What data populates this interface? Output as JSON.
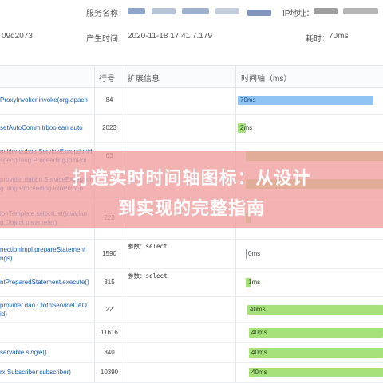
{
  "header": {
    "service_label": "服务名称：",
    "ip_label": "IP地址：",
    "trace_id_fragment": "09d2073",
    "created_label": "产生时间：",
    "created_value": "2020-11-18 17:41:7.179",
    "elapsed_label": "耗时：",
    "elapsed_value": "70ms"
  },
  "table": {
    "col_line": "行号",
    "col_ext": "扩展信息",
    "col_timeline": "时间轴（ms）"
  },
  "rows": [
    {
      "method": "ProxyInvoker.invoke(org.apach",
      "line": "84",
      "ext": "",
      "bar": "70ms",
      "bar_color": "blue"
    },
    {
      "method": "setAutoCommit(boolean auto",
      "line": "2023",
      "ext": "",
      "bar": "2ms",
      "bar_color": "green"
    },
    {
      "method": "ovider.dubbo.ServiceExceptionH\nspect).lang.ProceedingJoinPoi",
      "line": "63",
      "ext": "",
      "bar": "",
      "bar_color": "green"
    },
    {
      "method": "provider.dubbo.ServiceException\ng.lang.ProceedingJoinPoint p",
      "line": "",
      "ext": "",
      "bar": "",
      "bar_color": "green"
    },
    {
      "method": "ionTemplate.selectList(java.lan\ng.Object parameter)",
      "line": "223",
      "ext": "",
      "bar": "",
      "bar_color": "green"
    },
    {
      "method": "nectionImpl.prepareStatement\nngs)",
      "line": "1590",
      "ext": "参数：select",
      "bar": "0ms",
      "bar_color": "none"
    },
    {
      "method": "ntPreparedStatement.execute()",
      "line": "315",
      "ext": "参数：select",
      "bar": "1ms",
      "bar_color": "green"
    },
    {
      "method": "provider.dao.ClothServiceDAO.\nid)",
      "line": "22",
      "ext": "",
      "bar": "40ms",
      "bar_color": "green"
    },
    {
      "method": "",
      "line": "11616",
      "ext": "",
      "bar": "40ms",
      "bar_color": "green"
    },
    {
      "method": "servable.single()",
      "line": "340",
      "ext": "",
      "bar": "40ms",
      "bar_color": "green"
    },
    {
      "method": "rx.Subscriber subscriber)",
      "line": "10390",
      "ext": "",
      "bar": "40ms",
      "bar_color": "green"
    }
  ],
  "overlay": {
    "line1": "打造实时时间轴图标：从设计",
    "line2": "到实现的完整指南"
  },
  "colors": {
    "bar_blue": "#8fc3f2",
    "bar_green": "#a6e07a",
    "overlay": "#f0a0a0",
    "method_link": "#1a5fb4"
  }
}
